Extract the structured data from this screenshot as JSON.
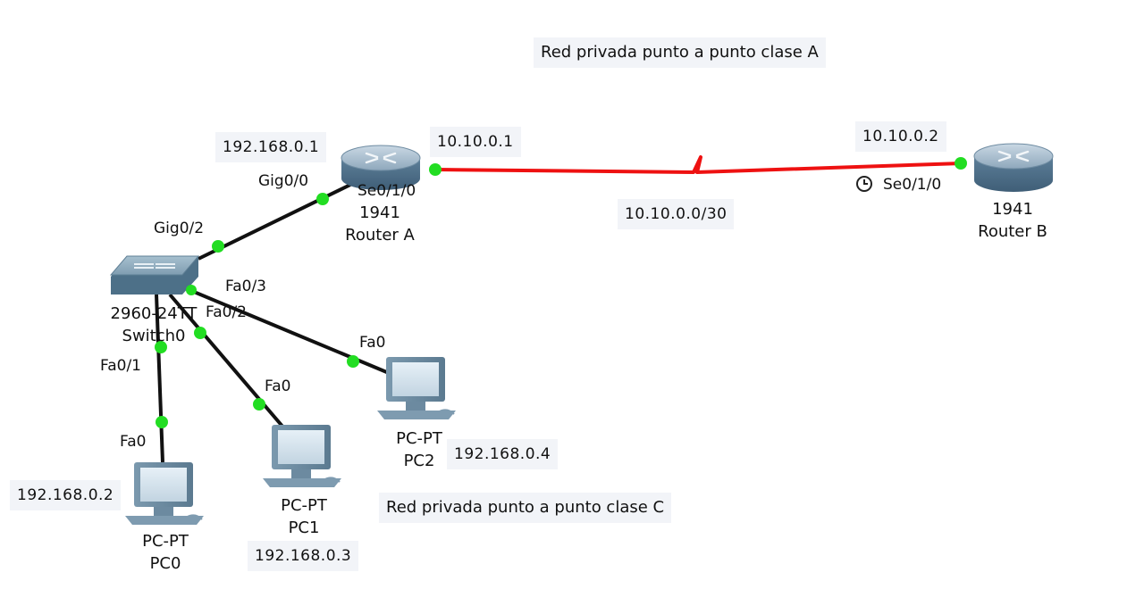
{
  "notes": {
    "class_a": "Red privada punto a punto clase A",
    "class_c": "Red privada punto a punto clase C"
  },
  "ips": {
    "router_a_lan": "192.168.0.1",
    "router_a_wan": "10.10.0.1",
    "router_b_wan": "10.10.0.2",
    "wan_net": "10.10.0.0/30",
    "pc0": "192.168.0.2",
    "pc1": "192.168.0.3",
    "pc2": "192.168.0.4"
  },
  "ports": {
    "ra_gig": "Gig0/0",
    "ra_se": "Se0/1/0",
    "rb_se": "Se0/1/0",
    "sw_gig": "Gig0/2",
    "sw_fa3": "Fa0/3",
    "sw_fa2": "Fa0/2",
    "sw_fa1": "Fa0/1",
    "pc0_fa": "Fa0",
    "pc1_fa": "Fa0",
    "pc2_fa": "Fa0"
  },
  "devices": {
    "router_a": {
      "model": "1941",
      "name": "Router A"
    },
    "router_b": {
      "model": "1941",
      "name": "Router B"
    },
    "switch0": {
      "model": "2960-24TT",
      "name": "Switch0"
    },
    "pc0": {
      "model": "PC-PT",
      "name": "PC0"
    },
    "pc1": {
      "model": "PC-PT",
      "name": "PC1"
    },
    "pc2": {
      "model": "PC-PT",
      "name": "PC2"
    }
  },
  "colors": {
    "serial_link": "#ee1111",
    "ethernet_link": "#111111",
    "link_up": "#22dd22"
  }
}
